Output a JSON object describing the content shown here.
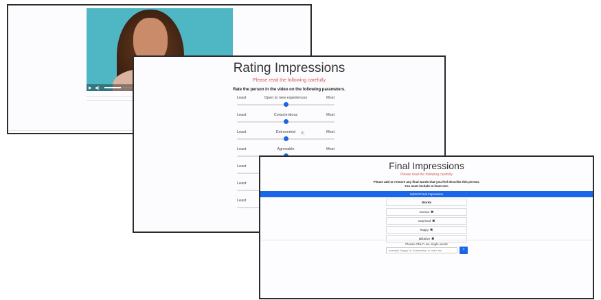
{
  "video": {
    "controls": {
      "play": "▶",
      "volume": "◀)",
      "progress": 0.15
    }
  },
  "rating": {
    "title": "Rating Impressions",
    "subtitle": "Please read the following carefully",
    "instruction": "Rate the person in the video on the following parameters.",
    "rows": [
      {
        "left": "Least",
        "label": "Open to new experiences",
        "right": "Most",
        "value": 0.5
      },
      {
        "left": "Least",
        "label": "Conscientious",
        "right": "Most",
        "value": 0.5
      },
      {
        "left": "Least",
        "label": "Extroverted",
        "right": "Most",
        "value": 0.5
      },
      {
        "left": "Least",
        "label": "Agreeable",
        "right": "Most",
        "value": 0.5
      },
      {
        "left": "Least",
        "label": "",
        "right": "",
        "value": 0.5
      },
      {
        "left": "Least",
        "label": "",
        "right": "",
        "value": 0.5
      },
      {
        "left": "Least",
        "label": "",
        "right": "",
        "value": 0.5
      }
    ],
    "accent": "#1a66e8"
  },
  "final": {
    "title": "Final Impressions",
    "subtitle": "Please read the following carefully",
    "instruction1": "Please add or remove any final words that you feel describe this person.",
    "instruction2": "You must include at least one.",
    "submit_label": "Submit Final Impression",
    "words_header": "Words",
    "words": [
      "woman",
      "surprised",
      "happy",
      "talkative"
    ],
    "remove_icon": "✖",
    "single_note": "Please ONLY use single words",
    "input_placeholder": "example 'happy' or 'trustworthy' or 'man' etc",
    "add_label": "+"
  }
}
